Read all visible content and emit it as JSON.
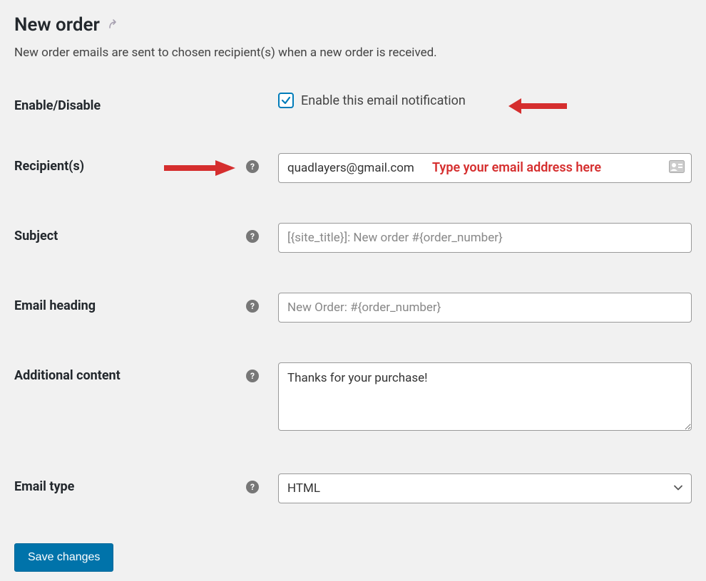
{
  "page": {
    "title": "New order",
    "description": "New order emails are sent to chosen recipient(s) when a new order is received."
  },
  "form": {
    "enable": {
      "label": "Enable/Disable",
      "checkbox_label": "Enable this email notification",
      "checked": true
    },
    "recipients": {
      "label": "Recipient(s)",
      "value": "quadlayers@gmail.com"
    },
    "subject": {
      "label": "Subject",
      "placeholder": "[{site_title}]: New order #{order_number}"
    },
    "heading": {
      "label": "Email heading",
      "placeholder": "New Order: #{order_number}"
    },
    "additional": {
      "label": "Additional content",
      "value": "Thanks for your purchase!"
    },
    "email_type": {
      "label": "Email type",
      "value": "HTML"
    }
  },
  "buttons": {
    "save": "Save changes"
  },
  "annotations": {
    "recipients_hint": "Type your email address here"
  }
}
